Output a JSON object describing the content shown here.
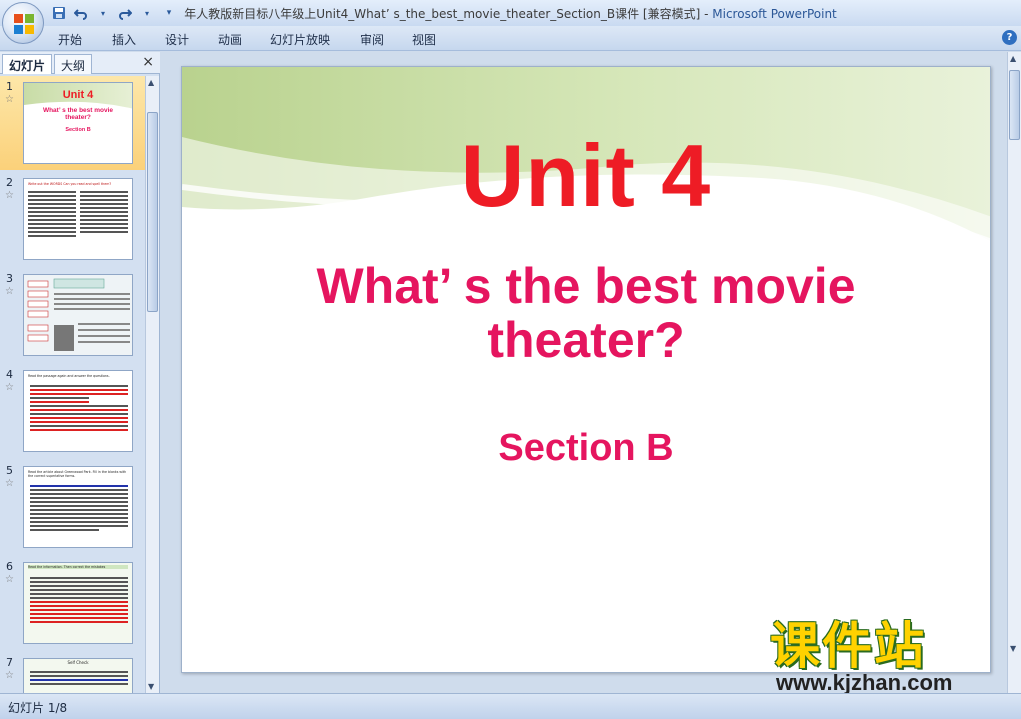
{
  "window": {
    "title": "年人教版新目标八年级上Unit4_What’ s_the_best_movie_theater_Section_B课件 [兼容模式]",
    "app_name": "Microsoft PowerPoint"
  },
  "qat": {
    "save_icon": "save-icon",
    "undo_icon": "undo-icon",
    "redo_icon": "redo-icon",
    "customize_icon": "chevron-down-icon"
  },
  "menu": {
    "items": [
      "开始",
      "插入",
      "设计",
      "动画",
      "幻灯片放映",
      "审阅",
      "视图"
    ]
  },
  "leftpanel": {
    "tabs": [
      "幻灯片",
      "大纲"
    ],
    "close": "×",
    "thumbnails": [
      {
        "num": "1",
        "title": "Unit 4",
        "line1": "What’ s the best movie",
        "line2": "theater?",
        "line3": "Section B"
      },
      {
        "num": "2",
        "head": "Write out the WORDS Can you read and spell them?"
      },
      {
        "num": "3"
      },
      {
        "num": "4",
        "head": "Read the passage again and answer the questions."
      },
      {
        "num": "5",
        "head": "Read the article about Greenwood Park. Fill in the blanks with the correct superlative forms."
      },
      {
        "num": "6",
        "head": "Read the information. Then correct the mistakes"
      },
      {
        "num": "7",
        "head": "Self Check"
      }
    ]
  },
  "slide": {
    "title": "Unit 4",
    "subtitle_line1": "What’ s the best movie",
    "subtitle_line2": "theater?",
    "section": "Section B"
  },
  "watermark": {
    "cn": "课件站",
    "url": "www.kjzhan.com"
  },
  "status": {
    "slide_info": "幻灯片 1/8"
  },
  "colors": {
    "title_red": "#ee1c25",
    "subtitle_pink": "#e5155f",
    "selected_thumb": "#fbd17a"
  }
}
